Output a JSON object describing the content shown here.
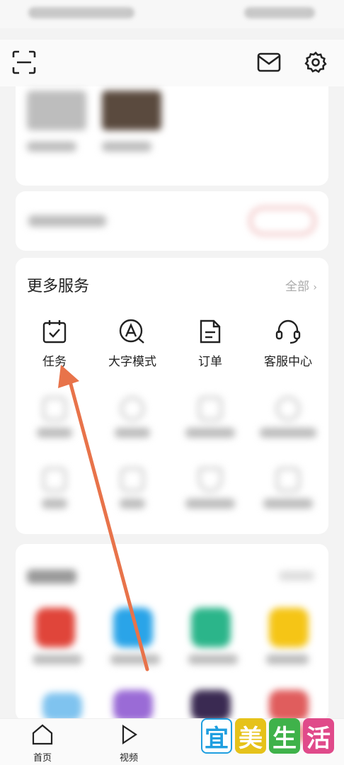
{
  "header": {
    "scan_icon": "scan-icon",
    "mail_icon": "mail-icon",
    "settings_icon": "gear-icon"
  },
  "more_services": {
    "title": "更多服务",
    "all_label": "全部",
    "items": [
      {
        "label": "任务",
        "icon": "task-calendar-icon"
      },
      {
        "label": "大字模式",
        "icon": "large-font-icon"
      },
      {
        "label": "订单",
        "icon": "order-document-icon"
      },
      {
        "label": "客服中心",
        "icon": "headset-icon"
      }
    ]
  },
  "tab_bar": {
    "tabs": [
      {
        "label": "首页",
        "icon": "home-icon"
      },
      {
        "label": "视频",
        "icon": "play-icon"
      }
    ]
  },
  "watermark": {
    "chars": [
      "宜",
      "美",
      "生",
      "活"
    ],
    "colors": [
      "#1f9fe0",
      "#ffffff",
      "#ffffff",
      "#ffffff"
    ]
  },
  "annotation": {
    "arrow_color": "#e8734a"
  }
}
